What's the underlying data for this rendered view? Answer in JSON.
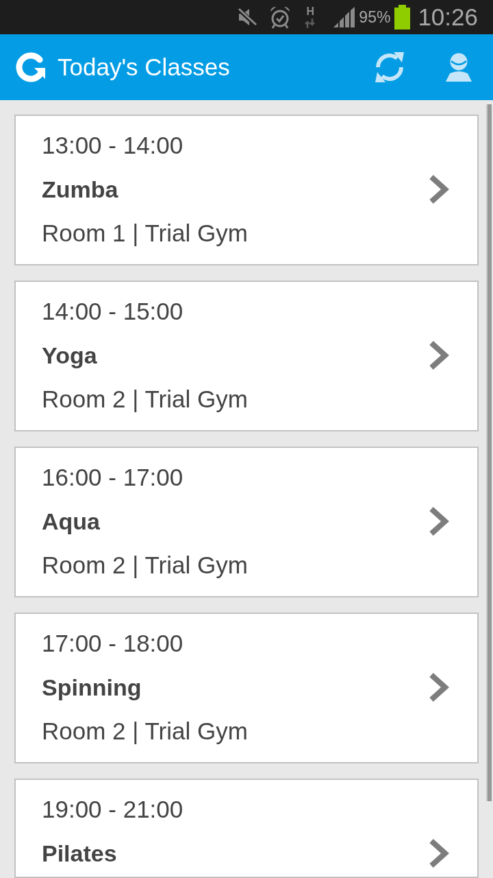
{
  "status_bar": {
    "network_type": "H",
    "battery_percent": "95%",
    "time": "10:26"
  },
  "app_bar": {
    "title": "Today's Classes"
  },
  "classes": [
    {
      "time": "13:00 - 14:00",
      "name": "Zumba",
      "room": "Room 1 | Trial Gym"
    },
    {
      "time": "14:00 - 15:00",
      "name": "Yoga",
      "room": "Room 2 | Trial Gym"
    },
    {
      "time": "16:00 - 17:00",
      "name": "Aqua",
      "room": "Room 2 | Trial Gym"
    },
    {
      "time": "17:00 - 18:00",
      "name": "Spinning",
      "room": "Room 2 | Trial Gym"
    },
    {
      "time": "19:00 - 21:00",
      "name": "Pilates"
    }
  ]
}
